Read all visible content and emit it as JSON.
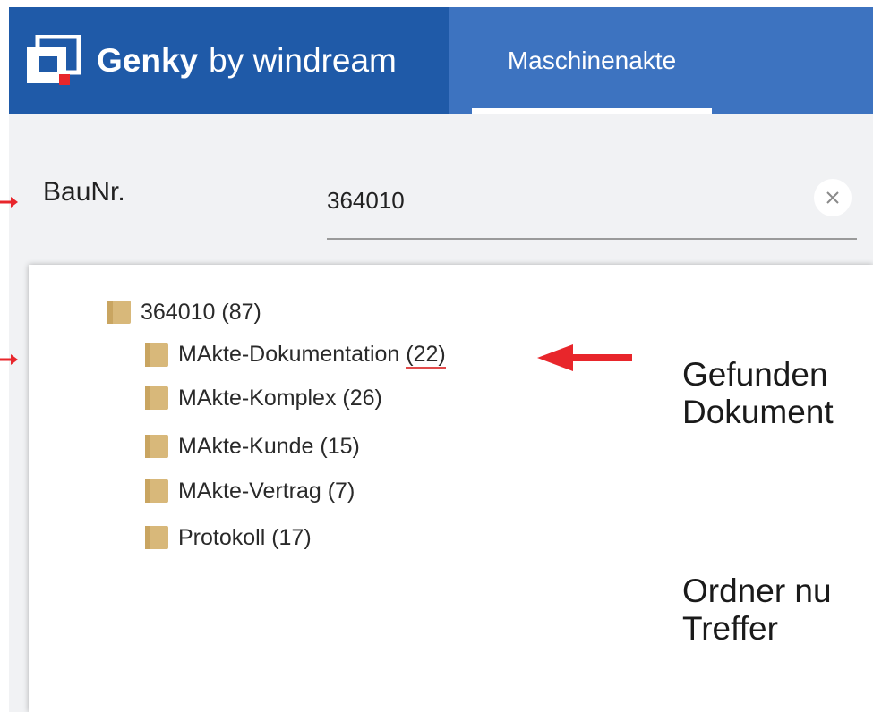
{
  "header": {
    "brand_name": "Genky",
    "brand_suffix": "by windream",
    "tab_label": "Maschinenakte"
  },
  "search": {
    "label": "BauNr.",
    "value": "364010"
  },
  "tree": {
    "root": {
      "label": "364010",
      "count": "(87)"
    },
    "children": [
      {
        "label": "MAkte-Dokumentation",
        "count": "(22)"
      },
      {
        "label": "MAkte-Komplex",
        "count": "(26)"
      },
      {
        "label": "MAkte-Kunde",
        "count": "(15)"
      },
      {
        "label": "MAkte-Vertrag",
        "count": "(7)"
      },
      {
        "label": "Protokoll",
        "count": "(17)"
      }
    ]
  },
  "annotations": {
    "note1_line1": "Gefunden",
    "note1_line2": "Dokument",
    "note2_line1": "Ordner nu",
    "note2_line2": "Treffer"
  },
  "colors": {
    "brand_blue": "#1f5aa8",
    "tab_blue": "#3d73c0",
    "folder_tan": "#d8b87a",
    "arrow_red": "#e8262b"
  },
  "icons": {
    "logo": "windream-logo-icon",
    "clear": "close-icon",
    "folder": "folder-icon"
  }
}
